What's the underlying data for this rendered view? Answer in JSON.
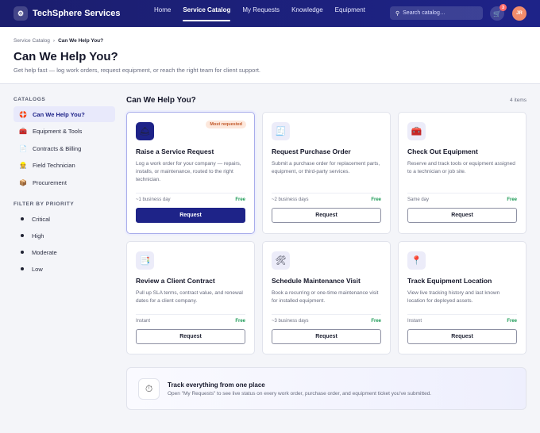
{
  "app": {
    "logo_glyph": "⚙",
    "name": "TechSphere Services"
  },
  "nav": [
    "Home",
    "Service Catalog",
    "My Requests",
    "Knowledge",
    "Equipment"
  ],
  "search": {
    "icon": "search-icon",
    "placeholder": "Search catalog…"
  },
  "cart": {
    "count": "3"
  },
  "user": {
    "initials": "JR"
  },
  "breadcrumb": {
    "parent": "Service Catalog",
    "separator": "›",
    "current": "Can We Help You?"
  },
  "page": {
    "title": "Can We Help You?",
    "subtitle": "Get help fast — log work orders, request equipment, or reach the right team for client support."
  },
  "sidebar": {
    "catalogs_heading": "CATALOGS",
    "catalogs": [
      {
        "icon": "🛟",
        "label": "Can We Help You?"
      },
      {
        "icon": "🧰",
        "label": "Equipment & Tools"
      },
      {
        "icon": "📄",
        "label": "Contracts & Billing"
      },
      {
        "icon": "👷",
        "label": "Field Technician"
      },
      {
        "icon": "📦",
        "label": "Procurement"
      }
    ],
    "filter_heading": "FILTER BY PRIORITY",
    "priorities": [
      "Critical",
      "High",
      "Moderate",
      "Low"
    ]
  },
  "main": {
    "title": "Can We Help You?",
    "count": "4 items"
  },
  "cards": [
    {
      "icon": "🛎",
      "tag": "Most requested",
      "title": "Raise a Service Request",
      "desc": "Log a work order for your company — repairs, installs, or maintenance, routed to the right technician.",
      "time": "~1 business day",
      "price": "Free",
      "button": "Request"
    },
    {
      "icon": "🧾",
      "title": "Request Purchase Order",
      "desc": "Submit a purchase order for replacement parts, equipment, or third-party services.",
      "time": "~2 business days",
      "price": "Free",
      "button": "Request"
    },
    {
      "icon": "🧰",
      "title": "Check Out Equipment",
      "desc": "Reserve and track tools or equipment assigned to a technician or job site.",
      "time": "Same day",
      "price": "Free",
      "button": "Request"
    },
    {
      "icon": "📑",
      "title": "Review a Client Contract",
      "desc": "Pull up SLA terms, contract value, and renewal dates for a client company.",
      "time": "Instant",
      "price": "Free",
      "button": "Request"
    },
    {
      "icon": "🛠",
      "title": "Schedule Maintenance Visit",
      "desc": "Book a recurring or one-time maintenance visit for installed equipment.",
      "time": "~3 business days",
      "price": "Free",
      "button": "Request"
    },
    {
      "icon": "📍",
      "title": "Track Equipment Location",
      "desc": "View live tracking history and last known location for deployed assets.",
      "time": "Instant",
      "price": "Free",
      "button": "Request"
    }
  ],
  "banner": {
    "icon": "⏱",
    "title": "Track everything from one place",
    "text": "Open \"My Requests\" to see live status on every work order, purchase order, and equipment ticket you've submitted."
  }
}
